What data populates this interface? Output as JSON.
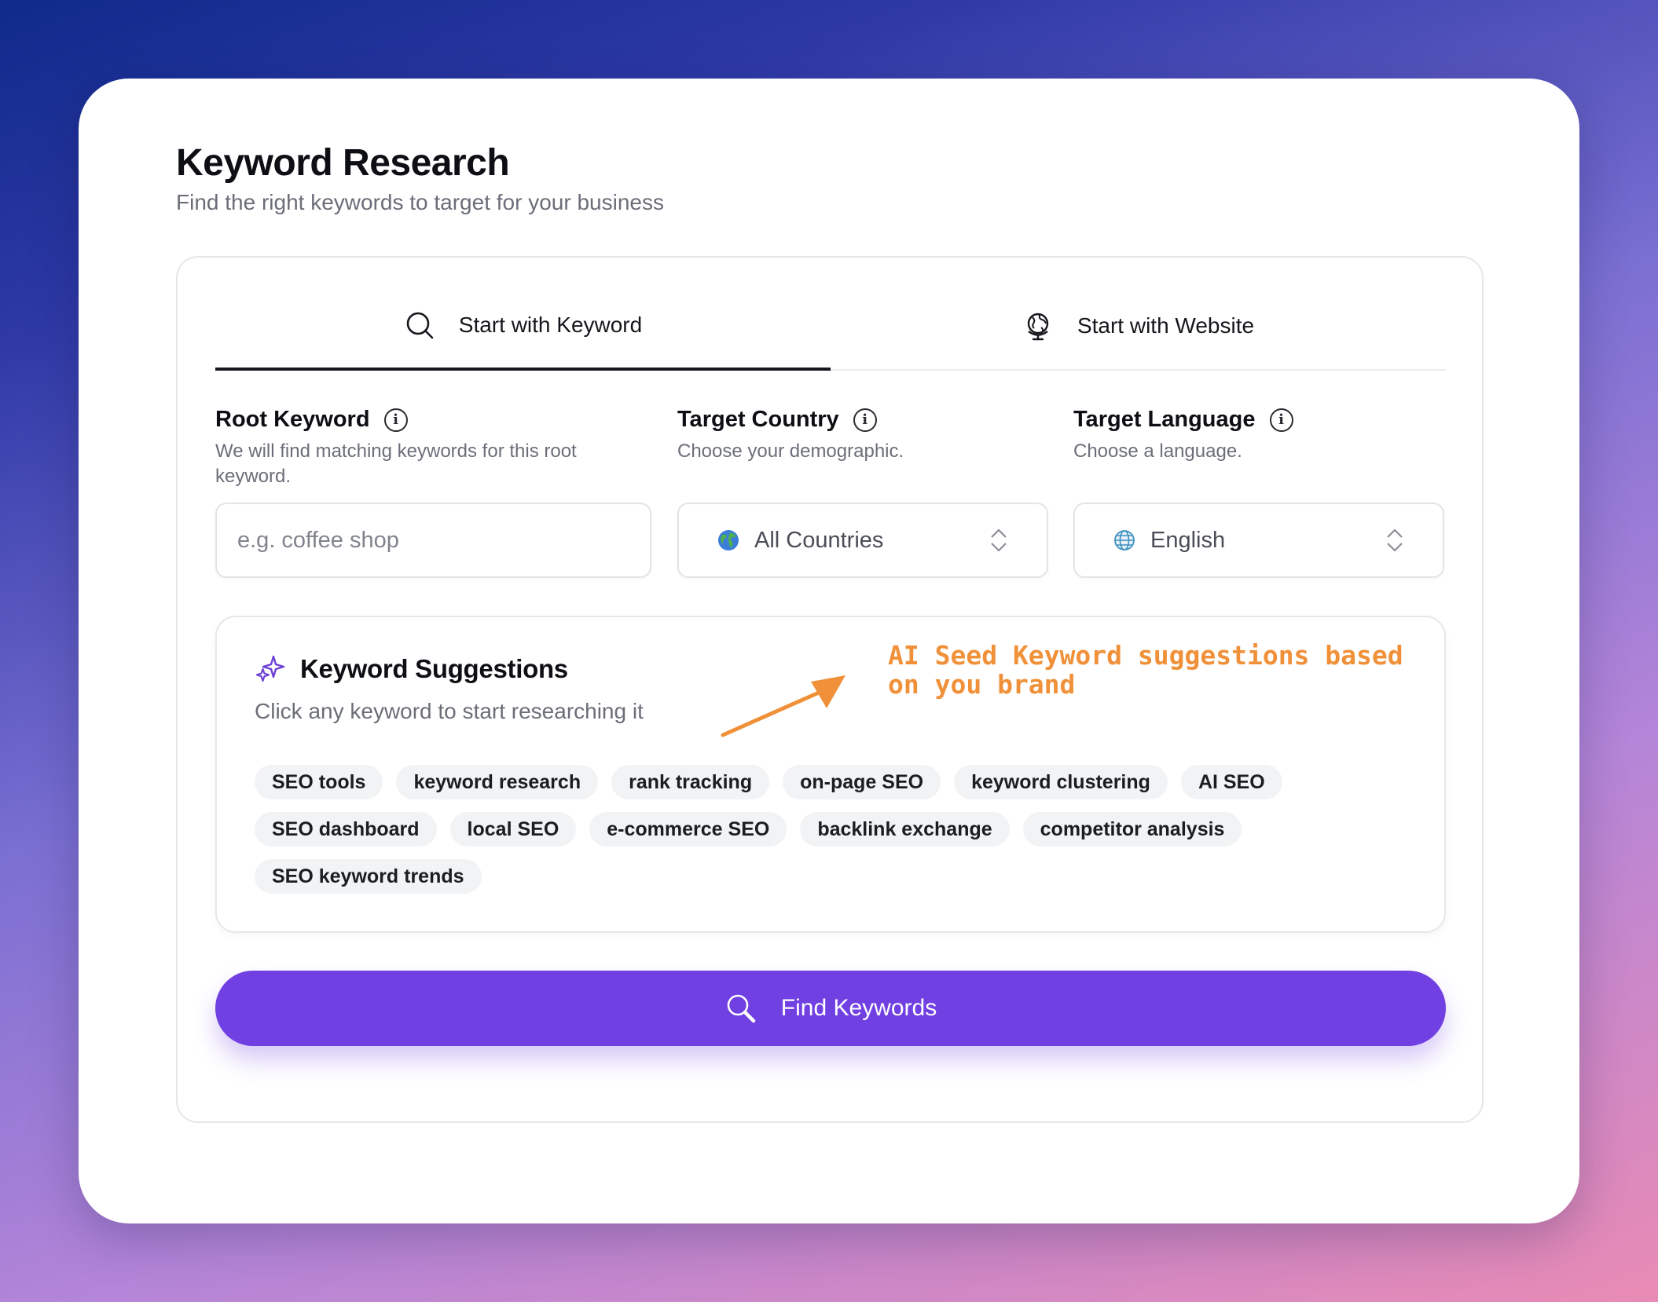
{
  "header": {
    "title": "Keyword Research",
    "subtitle": "Find the right keywords to target for your business"
  },
  "tabs": [
    {
      "label": "Start with Keyword",
      "icon": "search-icon",
      "active": true
    },
    {
      "label": "Start with Website",
      "icon": "globe-icon",
      "active": false
    }
  ],
  "fields": {
    "root_keyword": {
      "label": "Root Keyword",
      "help": "We will find matching keywords for this root keyword.",
      "value": "",
      "placeholder": "e.g. coffee shop"
    },
    "target_country": {
      "label": "Target Country",
      "help": "Choose your demographic.",
      "value": "All Countries",
      "icon": "earth-icon"
    },
    "target_language": {
      "label": "Target Language",
      "help": "Choose a language.",
      "value": "English",
      "icon": "globe-icon"
    }
  },
  "suggestions": {
    "title": "Keyword Suggestions",
    "subtitle": "Click any keyword to start researching it",
    "annotation": "AI Seed Keyword suggestions based on you brand",
    "chips": [
      "SEO tools",
      "keyword research",
      "rank tracking",
      "on-page SEO",
      "keyword clustering",
      "AI SEO",
      "SEO dashboard",
      "local SEO",
      "e-commerce SEO",
      "backlink exchange",
      "competitor analysis",
      "SEO keyword trends"
    ]
  },
  "action": {
    "find_label": "Find Keywords"
  },
  "colors": {
    "accent": "#7140e2",
    "annotation": "#f0913a",
    "sparkle": "#6d3fd8"
  }
}
